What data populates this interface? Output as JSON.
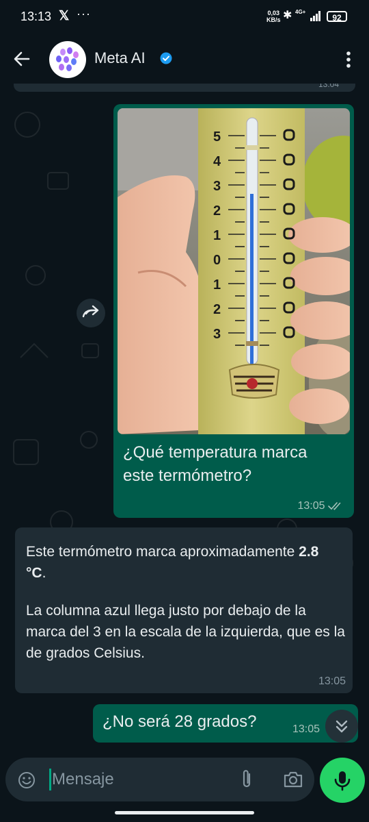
{
  "status_bar": {
    "time": "13:13",
    "x_logo": "𝕏",
    "more": "···",
    "speed_value": "0,03",
    "speed_unit": "KB/s",
    "network": "4G+",
    "battery": "92"
  },
  "header": {
    "contact_name": "Meta AI"
  },
  "messages": {
    "previous_time": "13:04",
    "image_caption": "¿Qué temperatura marca este termómetro?",
    "image_time": "13:05",
    "ai_intro": "Este termómetro marca aproximadamente ",
    "ai_value": "2.8 °C",
    "ai_after": ".",
    "ai_paragraph2": "La columna azul llega justo por debajo de la marca del 3 en la escala de la izquierda, que es la de grados Celsius.",
    "ai_time": "13:05",
    "user_reply": "¿No será 28 grados?",
    "user_reply_time": "13:05"
  },
  "composer": {
    "placeholder": "Mensaje"
  },
  "colors": {
    "background": "#0b141a",
    "outgoing_bubble": "#005c4b",
    "incoming_bubble": "#1f2c34",
    "accent_green": "#25d366",
    "verified_blue": "#1d9bf0"
  }
}
